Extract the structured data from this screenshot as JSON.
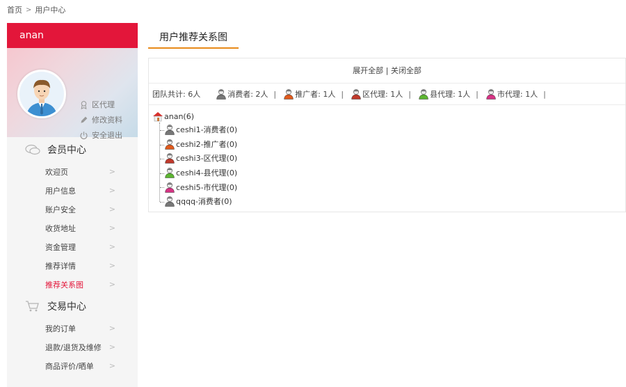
{
  "breadcrumb": {
    "home": "首页",
    "separator": ">",
    "current": "用户中心"
  },
  "sidebar": {
    "username": "anan",
    "profile_links": [
      {
        "label": "区代理",
        "icon": "medal-icon"
      },
      {
        "label": "修改资料",
        "icon": "pencil-icon"
      },
      {
        "label": "安全退出",
        "icon": "power-icon"
      }
    ],
    "member_section": {
      "title": "会员中心",
      "items": [
        {
          "label": "欢迎页"
        },
        {
          "label": "用户信息"
        },
        {
          "label": "账户安全"
        },
        {
          "label": "收货地址"
        },
        {
          "label": "资金管理"
        },
        {
          "label": "推荐详情"
        },
        {
          "label": "推荐关系图",
          "active": true
        }
      ]
    },
    "trade_section": {
      "title": "交易中心",
      "items": [
        {
          "label": "我的订单"
        },
        {
          "label": "退款/退货及维修"
        },
        {
          "label": "商品评价/晒单"
        }
      ]
    },
    "chevron": ">"
  },
  "main": {
    "tab_title": "用户推荐关系图",
    "expand_all": "展开全部",
    "divider": "|",
    "collapse_all": "关闭全部",
    "team_total": "团队共计: 6人",
    "stats": [
      {
        "label": "消费者: 2人",
        "color": "#777777"
      },
      {
        "label": "推广者: 1人",
        "color": "#e05a1c"
      },
      {
        "label": "区代理: 1人",
        "color": "#c0392b"
      },
      {
        "label": "县代理: 1人",
        "color": "#5cb531"
      },
      {
        "label": "市代理: 1人",
        "color": "#d63384"
      }
    ],
    "stat_pipe": "|",
    "tree": {
      "root": "anan(6)",
      "children": [
        {
          "label": "ceshi1-消费者(0)",
          "color": "#777777"
        },
        {
          "label": "ceshi2-推广者(0)",
          "color": "#e05a1c"
        },
        {
          "label": "ceshi3-区代理(0)",
          "color": "#c0392b"
        },
        {
          "label": "ceshi4-县代理(0)",
          "color": "#5cb531"
        },
        {
          "label": "ceshi5-市代理(0)",
          "color": "#d63384"
        },
        {
          "label": "qqqq-消费者(0)",
          "color": "#777777"
        }
      ]
    }
  },
  "colors": {
    "brand_red": "#e3163a",
    "tab_underline": "#e88a1a"
  }
}
